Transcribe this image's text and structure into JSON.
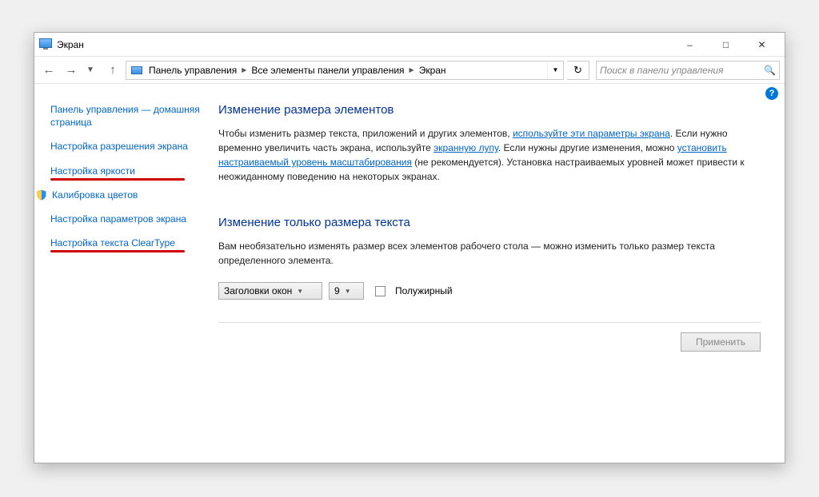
{
  "titlebar": {
    "title": "Экран"
  },
  "breadcrumbs": {
    "items": [
      "Панель управления",
      "Все элементы панели управления",
      "Экран"
    ]
  },
  "search": {
    "placeholder": "Поиск в панели управления"
  },
  "sidebar": {
    "home": "Панель управления — домашняя страница",
    "resolution": "Настройка разрешения экрана",
    "brightness": "Настройка яркости",
    "color_calibration": "Калибровка цветов",
    "screen_params": "Настройка параметров экрана",
    "cleartype": "Настройка текста ClearType"
  },
  "content": {
    "h1_size": "Изменение размера элементов",
    "p1a": "Чтобы изменить размер текста, приложений и других элементов, ",
    "p1_link1": "используйте эти параметры экрана",
    "p1b": ". Если нужно временно увеличить часть экрана, используйте ",
    "p1_link2": "экранную лупу",
    "p1c": ". Если нужны другие изменения, можно ",
    "p1_link3": "установить настраиваемый уровень масштабирования",
    "p1d": " (не рекомендуется). Установка настраиваемых уровней может привести к неожиданному поведению на некоторых экранах.",
    "h1_text": "Изменение только размера текста",
    "p2": "Вам необязательно изменять размер всех элементов рабочего стола — можно изменить только размер текста определенного элемента.",
    "combo_element": "Заголовки окон",
    "combo_size": "9",
    "checkbox_bold": "Полужирный",
    "apply": "Применить"
  }
}
